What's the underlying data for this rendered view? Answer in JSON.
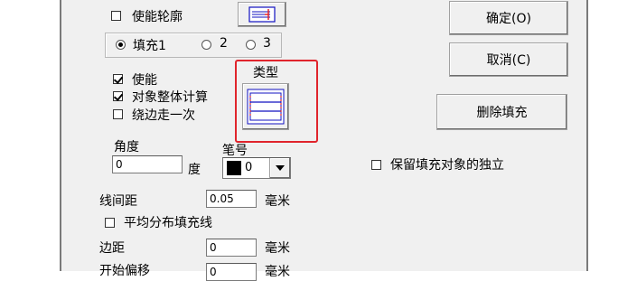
{
  "fill": {
    "enable_outline_label": "使能轮廓",
    "enable_outline_checked": true,
    "fill_radio": [
      {
        "label": "填充1",
        "selected": true
      },
      {
        "label": "2",
        "selected": false
      },
      {
        "label": "3",
        "selected": false
      }
    ],
    "enable_label": "使能",
    "enable_checked": true,
    "whole_calc_label": "对象整体计算",
    "whole_calc_checked": true,
    "edge_once_label": "绕边走一次",
    "edge_once_checked": false,
    "type_label": "类型",
    "angle_label": "角度",
    "angle_value": "0",
    "angle_unit": "度",
    "pen_label": "笔号",
    "pen_value": "0",
    "line_spacing_label": "线间距",
    "line_spacing_value": "0.05",
    "line_spacing_unit": "毫米",
    "even_distribute_label": "平均分布填充线",
    "even_distribute_checked": false,
    "margin_label": "边距",
    "margin_value": "0",
    "margin_unit": "毫米",
    "start_offset_label": "开始偏移",
    "start_offset_value": "0",
    "start_offset_unit": "毫米",
    "keep_independent_label": "保留填充对象的独立",
    "keep_independent_checked": false
  },
  "buttons": {
    "ok": "确定(O)",
    "cancel": "取消(C)",
    "delete_fill": "删除填充"
  },
  "colors": {
    "highlight": "#e0242c",
    "pen_color": "#000000"
  }
}
